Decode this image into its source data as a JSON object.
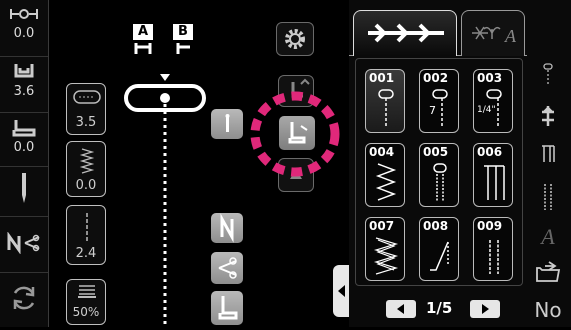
{
  "status": {
    "thread_tension": "0.0",
    "presser_height": "3.6",
    "feed": "0.0"
  },
  "params": {
    "stitch_width": "3.5",
    "stitch_length": "0.0",
    "third": "2.4",
    "speed": "50%"
  },
  "needle_position": {
    "a_label": "A",
    "b_label": "B"
  },
  "stitches": [
    {
      "num": "001",
      "sub": ""
    },
    {
      "num": "002",
      "sub": "7"
    },
    {
      "num": "003",
      "sub": "1/4\""
    },
    {
      "num": "004",
      "sub": ""
    },
    {
      "num": "005",
      "sub": ""
    },
    {
      "num": "006",
      "sub": ""
    },
    {
      "num": "007",
      "sub": ""
    },
    {
      "num": "008",
      "sub": ""
    },
    {
      "num": "009",
      "sub": ""
    }
  ],
  "pagination": {
    "page": "1/5"
  },
  "side": {
    "no_label": "No",
    "a_label": "A"
  },
  "colors": {
    "highlight": "#e0287a"
  }
}
